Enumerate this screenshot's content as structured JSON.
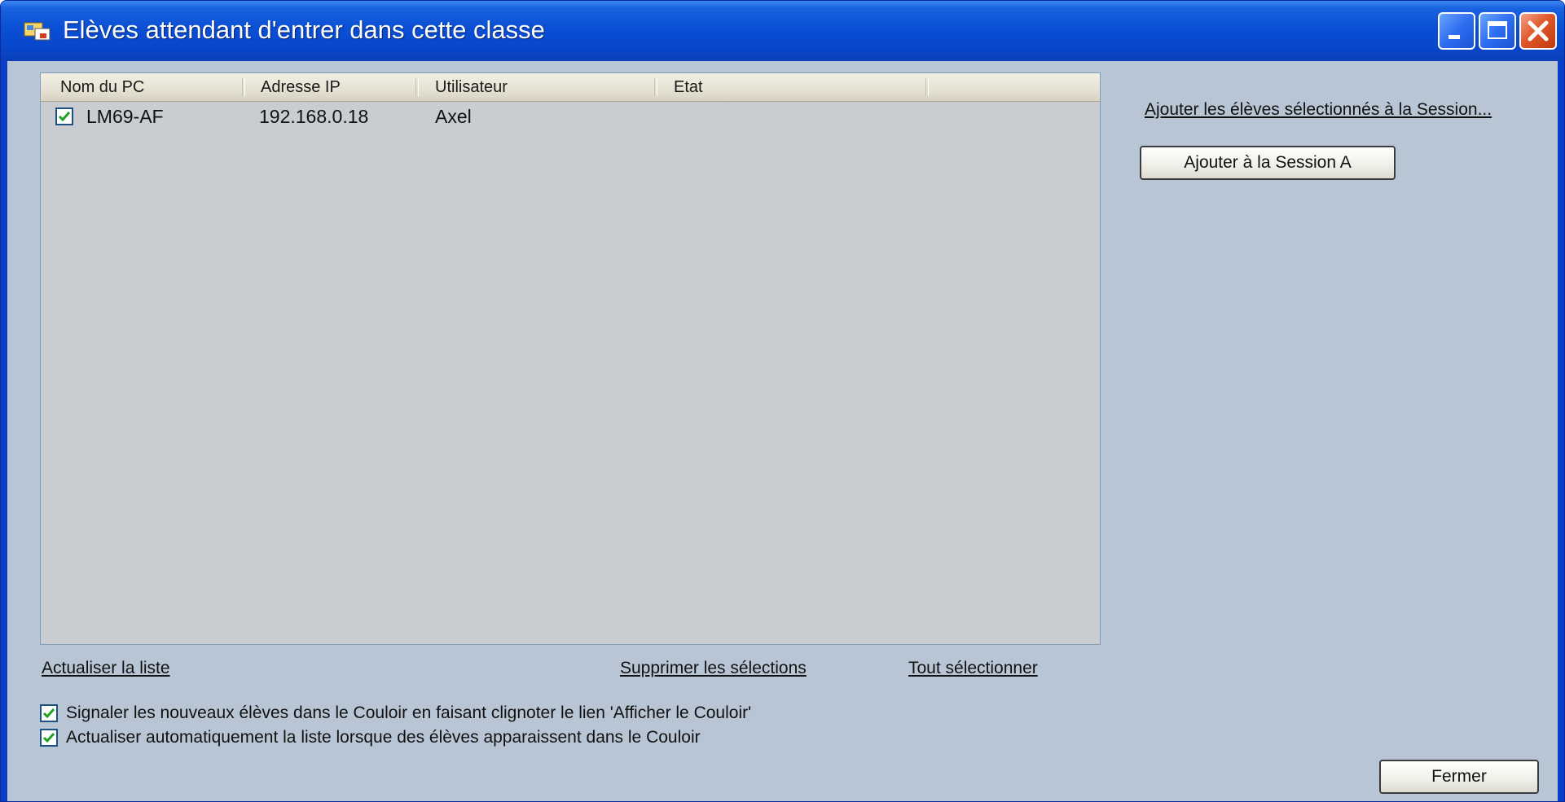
{
  "window": {
    "title": "Elèves attendant d'entrer dans cette classe"
  },
  "list": {
    "columns": [
      "Nom du PC",
      "Adresse IP",
      "Utilisateur",
      "Etat"
    ],
    "rows": [
      {
        "checked": true,
        "pc": "LM69-AF",
        "ip": "192.168.0.18",
        "user": "Axel",
        "state": ""
      }
    ]
  },
  "links": {
    "refresh": "Actualiser la liste",
    "remove": "Supprimer les sélections",
    "select_all": "Tout sélectionner",
    "add_selected": "Ajouter les élèves sélectionnés à la Session..."
  },
  "buttons": {
    "add_session": "Ajouter à la Session A",
    "close": "Fermer"
  },
  "options": {
    "blink": {
      "checked": true,
      "label": "Signaler les nouveaux élèves dans le Couloir en faisant clignoter le lien 'Afficher le Couloir'"
    },
    "auto_refresh": {
      "checked": true,
      "label": "Actualiser automatiquement la liste lorsque des élèves apparaissent dans le Couloir"
    }
  },
  "colors": {
    "title_bar": "#0a4fd4",
    "client_bg": "#b8c5d4",
    "list_bg": "#c9ccd1",
    "check_mark": "#21a121"
  },
  "icons": {
    "app": "app-icon",
    "minimize": "minimize-icon",
    "maximize": "maximize-icon",
    "close": "close-icon",
    "check": "checkmark-icon"
  }
}
